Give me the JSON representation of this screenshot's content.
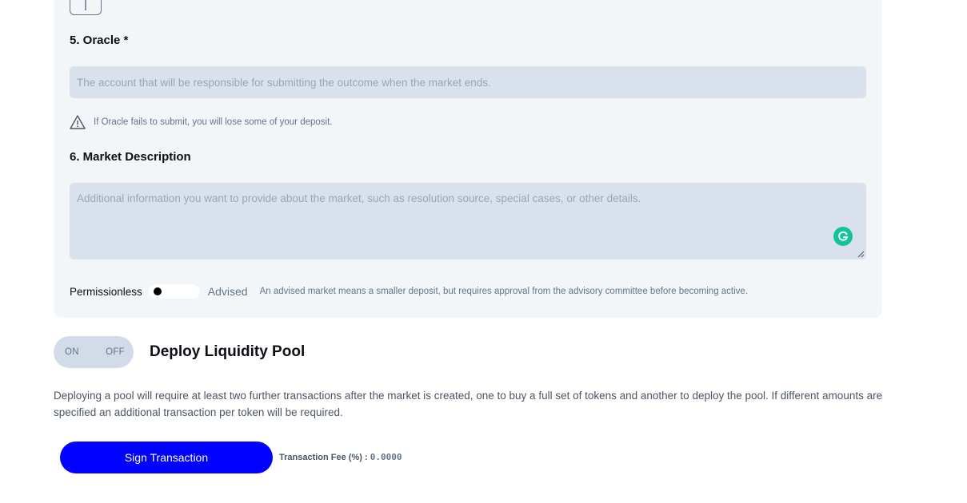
{
  "oracle": {
    "heading": "5. Oracle *",
    "placeholder": "The account that will be responsible for submitting the outcome when the market ends.",
    "warning": "If Oracle fails to submit, you will lose some of your deposit."
  },
  "description": {
    "heading": "6. Market Description",
    "placeholder": "Additional information you want to provide about the market, such as resolution source, special cases, or other details."
  },
  "permission": {
    "left_label": "Permissionless",
    "right_label": "Advised",
    "help": "An advised market means a smaller deposit, but requires approval from the advisory committee before becoming active."
  },
  "liquidity": {
    "on_label": "ON",
    "off_label": "OFF",
    "title": "Deploy Liquidity Pool",
    "description": "Deploying a pool will require at least two further transactions after the market is created, one to buy a full set of tokens and another to deploy the pool. If different amounts are specified an additional transaction per token will be required."
  },
  "footer": {
    "sign_label": "Sign Transaction",
    "fee_label": "Transaction Fee (%) :",
    "fee_value": "0.0000"
  },
  "colors": {
    "accent": "#0001fe",
    "panel": "#f3f6f9",
    "input": "#d9e2ec",
    "grammarly": "#15c39a"
  }
}
